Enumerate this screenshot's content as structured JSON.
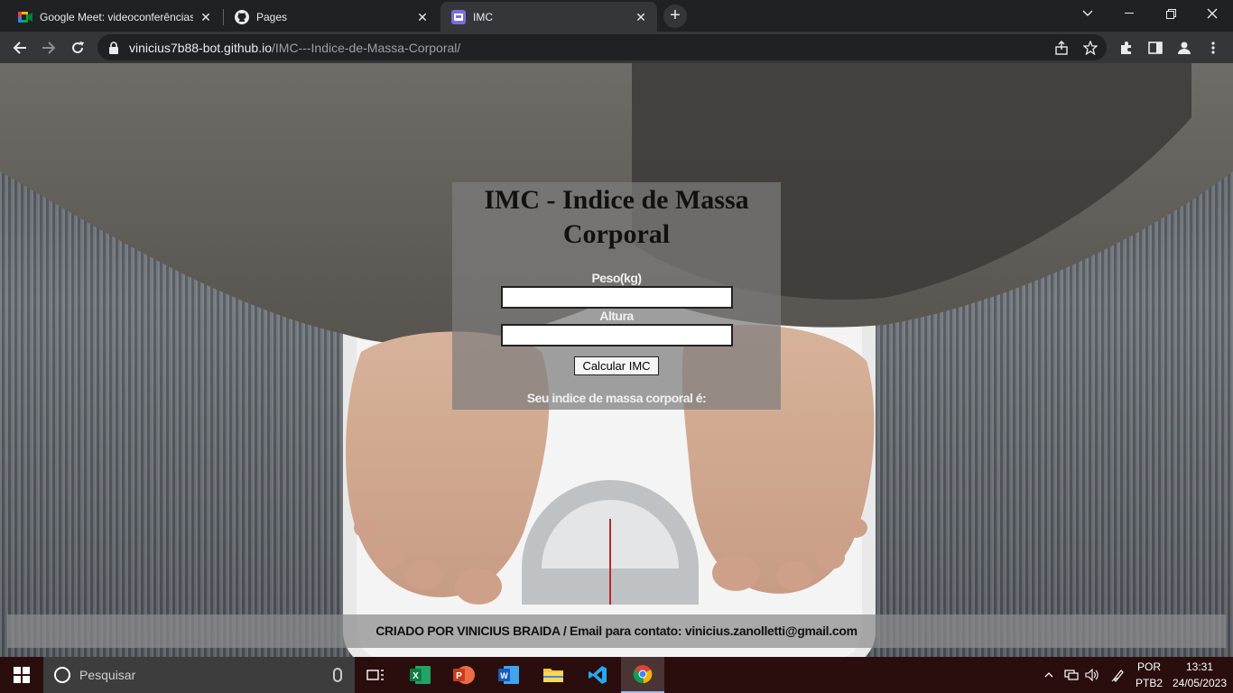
{
  "browser": {
    "tabs": [
      {
        "title": "Google Meet: videoconferências",
        "active": false
      },
      {
        "title": "Pages",
        "active": false
      },
      {
        "title": "IMC",
        "active": true
      }
    ],
    "url_host": "vinicius7b88-bot.github.io",
    "url_path": "/IMC---Indice-de-Massa-Corporal/"
  },
  "page": {
    "heading": "IMC - Indice de Massa Corporal",
    "peso_label": "Peso(kg)",
    "altura_label": "Altura",
    "peso_value": "",
    "altura_value": "",
    "button_label": "Calcular IMC",
    "result_label": "Seu indice de massa corporal é:",
    "footer": "CRIADO POR VINICIUS BRAIDA / Email para contato: vinicius.zanolletti@gmail.com"
  },
  "taskbar": {
    "search_placeholder": "Pesquisar",
    "apps": [
      "task-view",
      "excel",
      "powerpoint",
      "word",
      "file-explorer",
      "vscode",
      "chrome"
    ],
    "lang_top": "POR",
    "lang_bottom": "PTB2",
    "time": "13:31",
    "date": "24/05/2023"
  },
  "colors": {
    "accent_tab": "#35363a",
    "taskbar": "#2a0e0e"
  }
}
